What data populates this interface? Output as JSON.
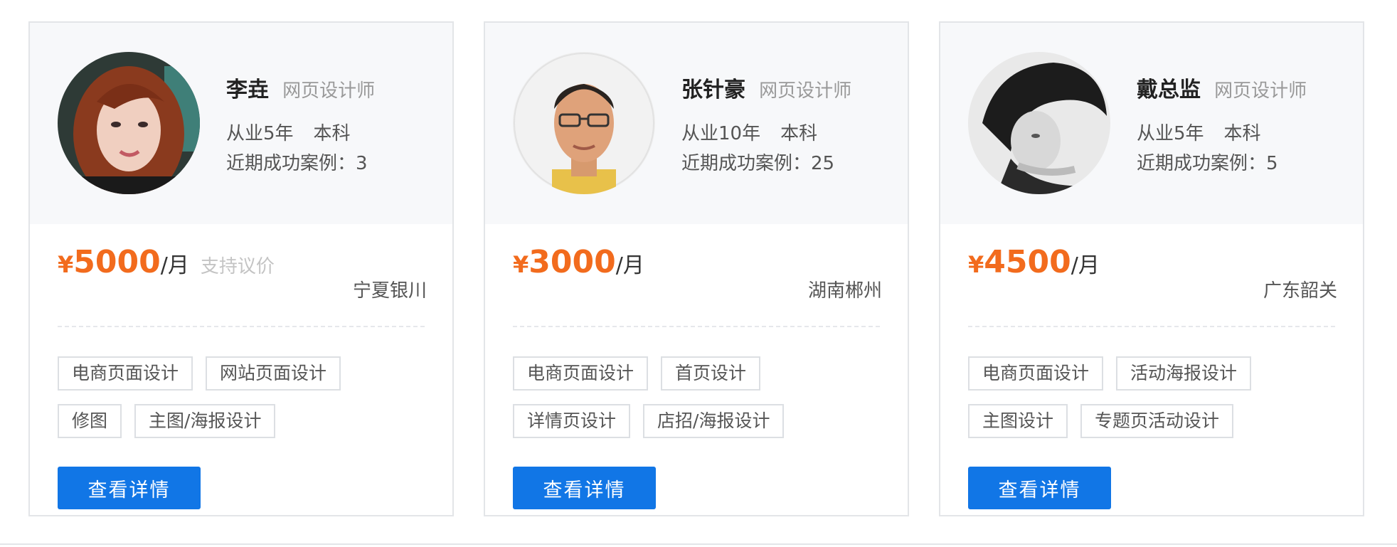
{
  "designers": [
    {
      "name": "李垚",
      "role": "网页设计师",
      "experience": "从业5年",
      "education": "本科",
      "cases_label": "近期成功案例：",
      "cases_count": "3",
      "currency": "¥",
      "price": "5000",
      "per": "/月",
      "negotiable": "支持议价",
      "location": "宁夏银川",
      "tags": [
        [
          "电商页面设计",
          "网站页面设计"
        ],
        [
          "修图",
          "主图/海报设计"
        ]
      ],
      "button": "查看详情"
    },
    {
      "name": "张针豪",
      "role": "网页设计师",
      "experience": "从业10年",
      "education": "本科",
      "cases_label": "近期成功案例：",
      "cases_count": "25",
      "currency": "¥",
      "price": "3000",
      "per": "/月",
      "negotiable": "",
      "location": "湖南郴州",
      "tags": [
        [
          "电商页面设计",
          "首页设计"
        ],
        [
          "详情页设计",
          "店招/海报设计"
        ]
      ],
      "button": "查看详情"
    },
    {
      "name": "戴总监",
      "role": "网页设计师",
      "experience": "从业5年",
      "education": "本科",
      "cases_label": "近期成功案例：",
      "cases_count": "5",
      "currency": "¥",
      "price": "4500",
      "per": "/月",
      "negotiable": "",
      "location": "广东韶关",
      "tags": [
        [
          "电商页面设计",
          "活动海报设计"
        ],
        [
          "主图设计",
          "专题页活动设计"
        ]
      ],
      "button": "查看详情"
    }
  ],
  "colors": {
    "price": "#f26b1d",
    "button": "#1176e6",
    "card_top": "#f7f8fa"
  }
}
